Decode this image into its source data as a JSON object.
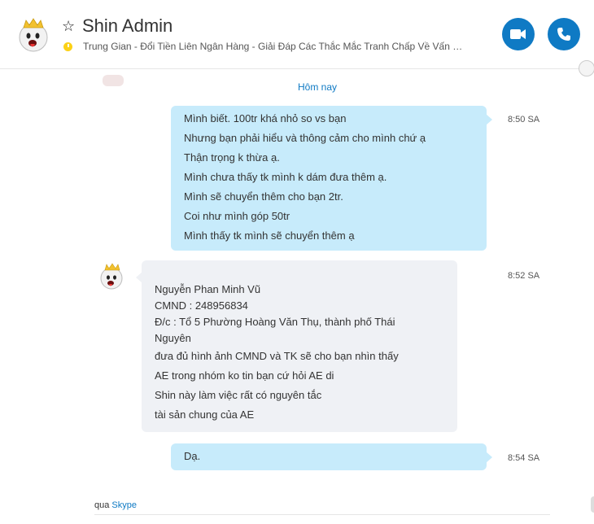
{
  "header": {
    "contact_name": "Shin Admin",
    "mood_message": "Trung Gian - Đổi Tiền Liên Ngân Hàng - Giải Đáp Các Thắc Mắc Tranh Chấp Về Vấn Đề...",
    "status": "away",
    "icons": [
      "ghost-avatar-icon",
      "star-icon",
      "away-status-icon",
      "video-call-icon",
      "voice-call-icon",
      "globe-icon"
    ]
  },
  "chat": {
    "day_separator": "Hôm nay",
    "messages": [
      {
        "direction": "outgoing",
        "time": "8:50 SA",
        "lines": [
          "Mình biết. 100tr khá nhỏ so vs bạn",
          "Nhưng bạn phải hiểu và thông cảm cho mình chứ ạ",
          "Thận trọng k thừa ạ.",
          "Mình chưa thấy tk mình k dám đưa thêm ạ.",
          "Mình sẽ chuyển thêm cho bạn 2tr.",
          "Coi như mình góp 50tr",
          "Mình thấy tk mình sẽ chuyển thêm ạ"
        ]
      },
      {
        "direction": "incoming",
        "time": "8:52 SA",
        "lines": [
          "Nguyễn Phan Minh Vũ",
          "CMND : 248956834",
          "Đ/c : Tổ 5 Phường Hoàng Văn Thụ, thành phố Thái",
          "Nguyên",
          "đưa đủ hình ảnh CMND và TK sẽ cho bạn nhìn thấy",
          "AE trong nhóm ko tin bạn cứ hỏi AE di",
          "Shin này làm việc rất có nguyên tắc",
          "tài sản chung của AE"
        ]
      },
      {
        "direction": "outgoing",
        "time": "8:54 SA",
        "lines": [
          "Dạ."
        ]
      }
    ]
  },
  "footer": {
    "via_label": "qua",
    "via_link": "Skype"
  },
  "colors": {
    "accent": "#0f7ac4",
    "outgoing_bubble": "#c7ebfb",
    "incoming_bubble": "#eff1f5",
    "away": "#fcd116"
  }
}
